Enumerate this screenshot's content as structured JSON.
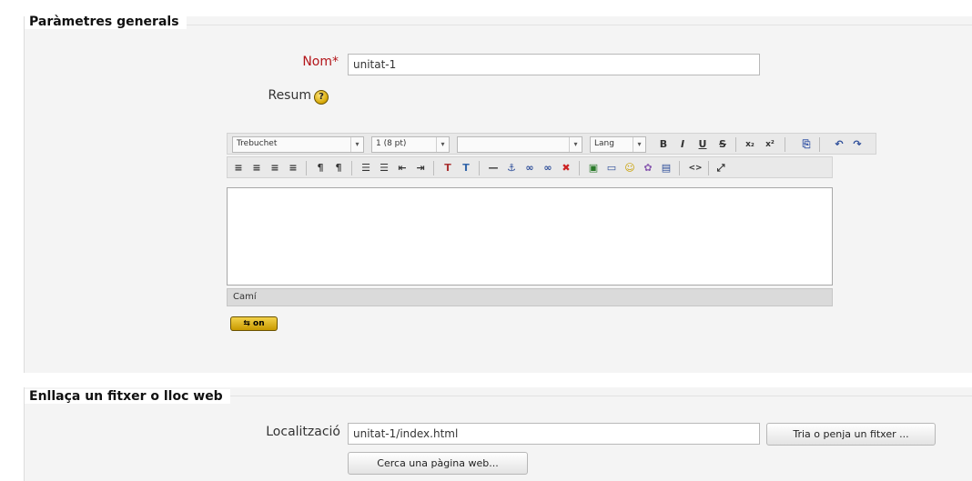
{
  "general": {
    "legend": "Paràmetres generals",
    "name_label": "Nom*",
    "name_value": "unitat-1",
    "summary_label": "Resum",
    "help_glyph": "?",
    "help_icon": "help-icon"
  },
  "editor": {
    "font_family": "Trebuchet",
    "font_size": "1 (8 pt)",
    "style": "",
    "lang": "Lang",
    "row1_buttons": [
      "B",
      "I",
      "U",
      "S",
      "x₂",
      "x²",
      "⎘",
      "↶",
      "↷"
    ],
    "row2_buttons": [
      "≡",
      "≡",
      "≡",
      "≡",
      "¶",
      "¶",
      "☰",
      "☰",
      "⇤",
      "⇥",
      "T",
      "T",
      "—",
      "⚓",
      "∞",
      "∞",
      "✖",
      "▣",
      "▭",
      "☺",
      "✿",
      "▤",
      "<>",
      "⤢"
    ],
    "status_path": "Camí",
    "toggle_label": "⇆ on"
  },
  "link": {
    "legend": "Enllaça un fitxer o lloc web",
    "location_label": "Localització",
    "location_value": "unitat-1/index.html",
    "choose_button": "Tria o penja un fitxer ...",
    "search_button": "Cerca una pàgina web..."
  }
}
